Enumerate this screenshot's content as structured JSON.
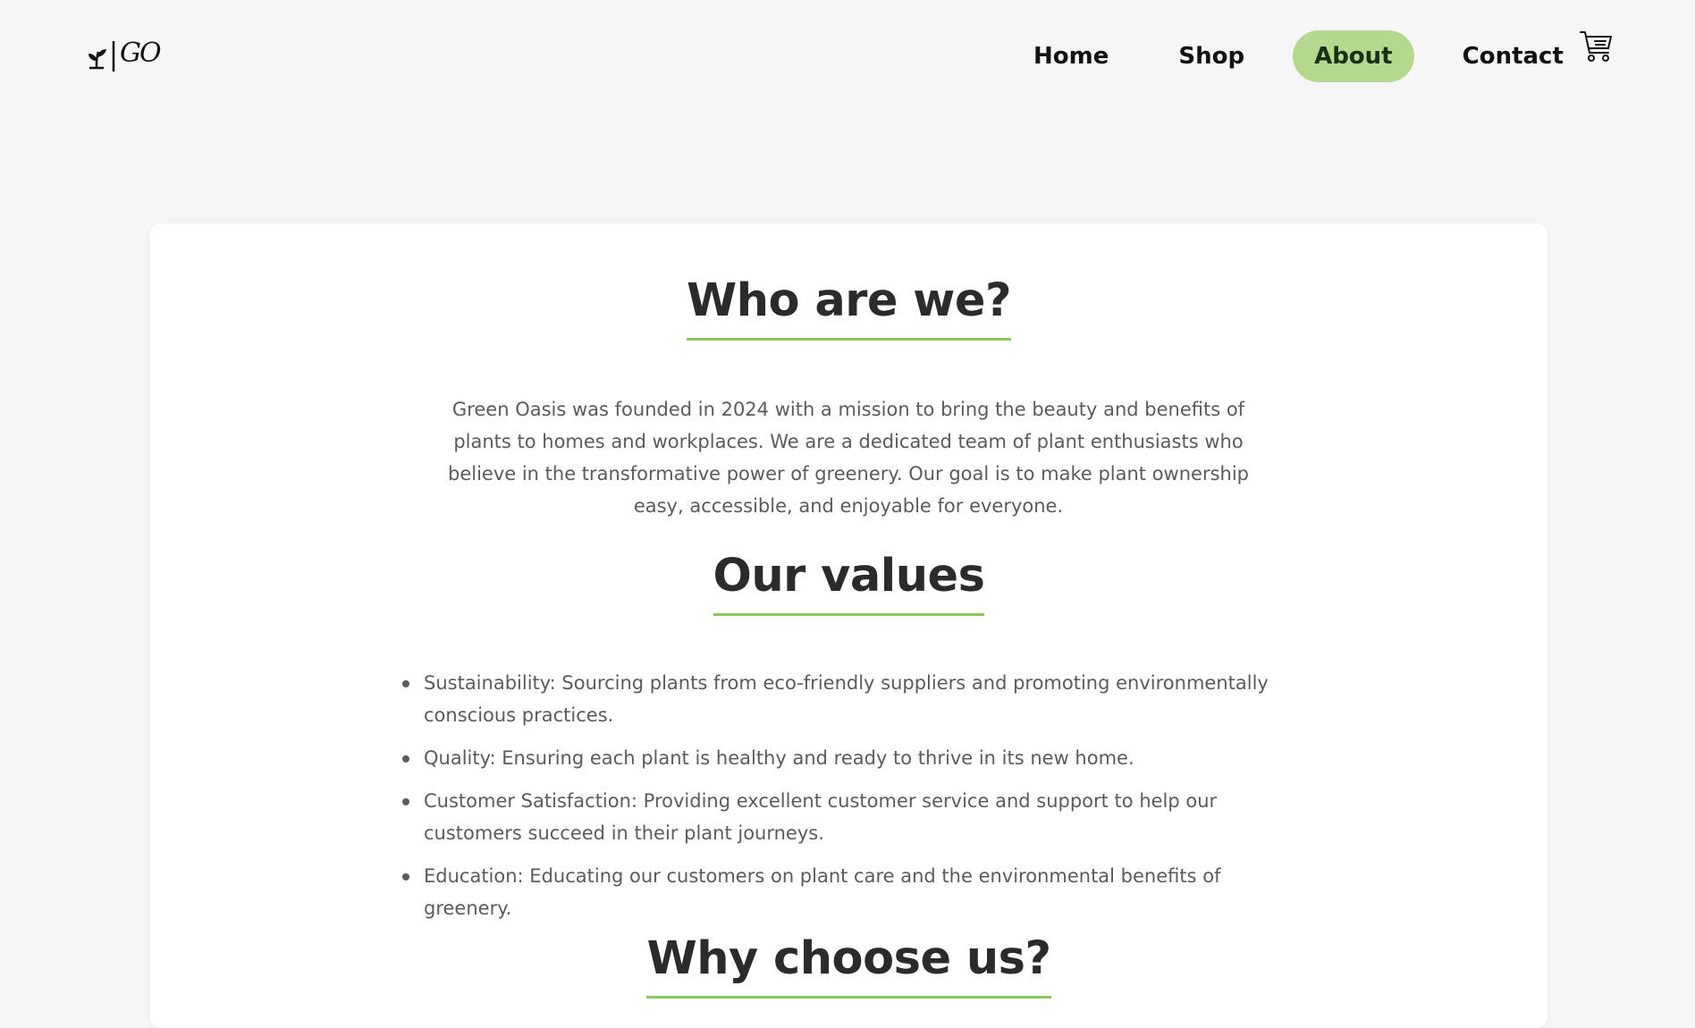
{
  "header": {
    "logo_text": "GO",
    "nav": [
      {
        "label": "Home",
        "active": false
      },
      {
        "label": "Shop",
        "active": false
      },
      {
        "label": "About",
        "active": true
      },
      {
        "label": "Contact",
        "active": false
      }
    ],
    "cart_icon": "shopping-cart-icon"
  },
  "about": {
    "title": "Who are we?",
    "text": "Green Oasis was founded in 2024 with a mission to bring the beauty and benefits of plants to homes and workplaces. We are a dedicated team of plant enthusiasts who believe in the transformative power of greenery. Our goal is to make plant ownership easy, accessible, and enjoyable for everyone."
  },
  "values": {
    "title": "Our values",
    "items": [
      "Sustainability: Sourcing plants from eco-friendly suppliers and promoting environmentally conscious practices.",
      "Quality: Ensuring each plant is healthy and ready to thrive in its new home.",
      "Customer Satisfaction: Providing excellent customer service and support to help our customers succeed in their plant journeys.",
      "Education: Educating our customers on plant care and the environmental benefits of greenery."
    ]
  },
  "why": {
    "title": "Why choose us?"
  },
  "colors": {
    "background": "#f6f6f6",
    "card": "#ffffff",
    "accent": "#8cc65a",
    "active_nav": "#b5d88f",
    "text": "#5b5b5b",
    "heading": "#2b2b2b"
  }
}
